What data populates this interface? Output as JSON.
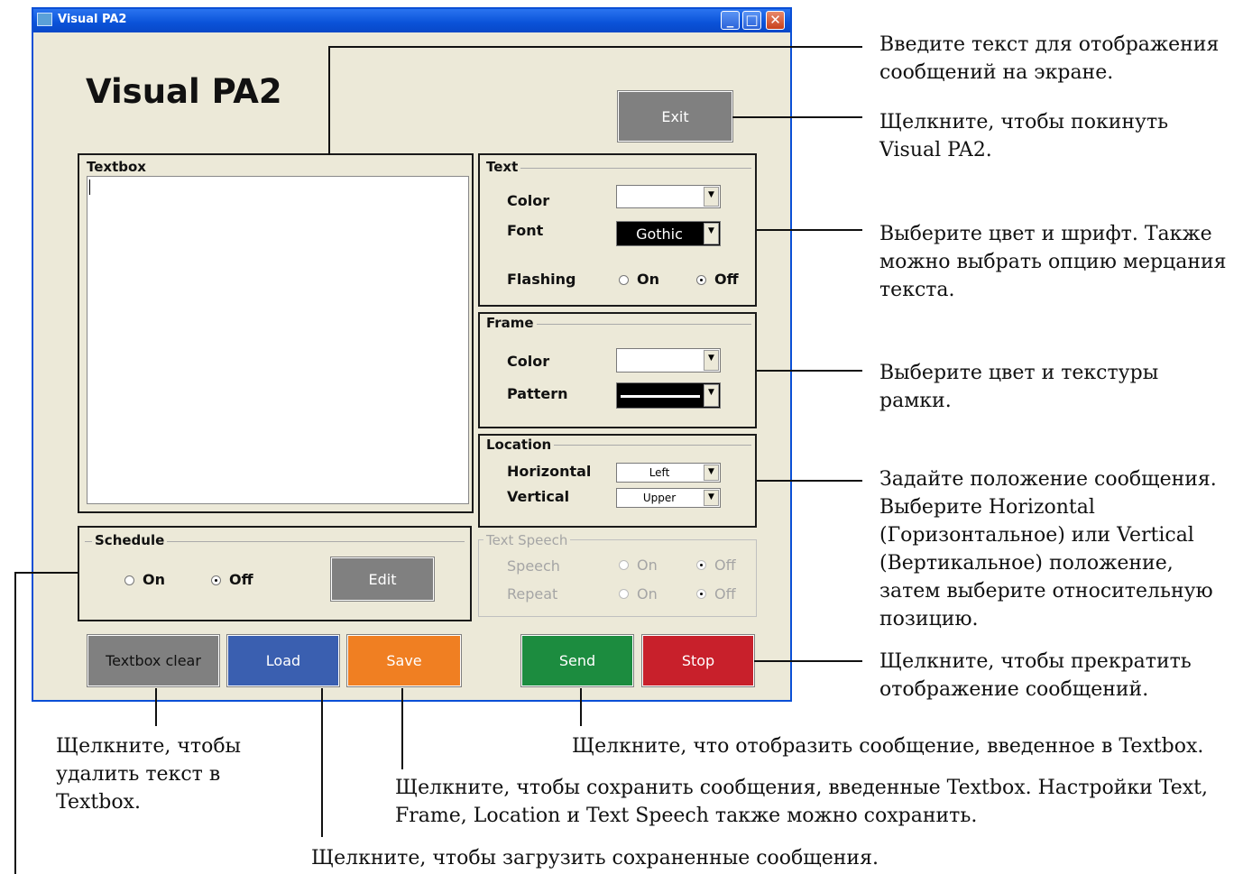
{
  "window": {
    "title": "Visual PA2",
    "app_title": "Visual PA2",
    "minimize_glyph": "_",
    "maximize_glyph": "□",
    "close_glyph": "✕"
  },
  "exit_button": "Exit",
  "textbox": {
    "label": "Textbox",
    "value": ""
  },
  "text_group": {
    "label": "Text",
    "color_label": "Color",
    "color_value": "",
    "font_label": "Font",
    "font_value": "Gothic",
    "flashing_label": "Flashing",
    "on_label": "On",
    "off_label": "Off",
    "flashing_selected": "Off"
  },
  "frame_group": {
    "label": "Frame",
    "color_label": "Color",
    "color_value": "",
    "pattern_label": "Pattern"
  },
  "location_group": {
    "label": "Location",
    "horizontal_label": "Horizontal",
    "horizontal_value": "Left",
    "vertical_label": "Vertical",
    "vertical_value": "Upper"
  },
  "speech_group": {
    "label": "Text Speech",
    "speech_label": "Speech",
    "repeat_label": "Repeat",
    "on_label": "On",
    "off_label": "Off"
  },
  "schedule_group": {
    "label": "Schedule",
    "on_label": "On",
    "off_label": "Off",
    "edit_label": "Edit",
    "selected": "Off"
  },
  "buttons": {
    "textbox_clear": "Textbox clear",
    "load": "Load",
    "save": "Save",
    "send": "Send",
    "stop": "Stop"
  },
  "colors": {
    "gray_button": "#808080",
    "load": "#3a5fb0",
    "save": "#f07f22",
    "send": "#1c8c3f",
    "stop": "#c8202b",
    "titlebar": "#0a52d8"
  },
  "annotations": {
    "textbox": "Введите текст для отображения сообщений на экране.",
    "exit": "Щелкните, чтобы покинуть Visual PA2.",
    "text": "Выберите цвет и шрифт. Также можно выбрать опцию мерцания текста.",
    "frame": "Выберите цвет и текстуры рамки.",
    "location": "Задайте положение сообщения. Выберите Horizontal (Горизонтальное) или Vertical (Вертикальное) положение, затем выберите относительную позицию.",
    "stop": "Щелкните, чтобы прекратить отображение сообщений.",
    "clear": "Щелкните, чтобы удалить текст в Textbox.",
    "send": "Щелкните, что отобразить сообщение, введенное в Textbox.",
    "save": "Щелкните, чтобы сохранить сообщения, введенные Textbox. Настройки Text, Frame, Location и Text Speech также можно сохранить.",
    "load": "Щелкните, чтобы загрузить сохраненные сообщения."
  }
}
